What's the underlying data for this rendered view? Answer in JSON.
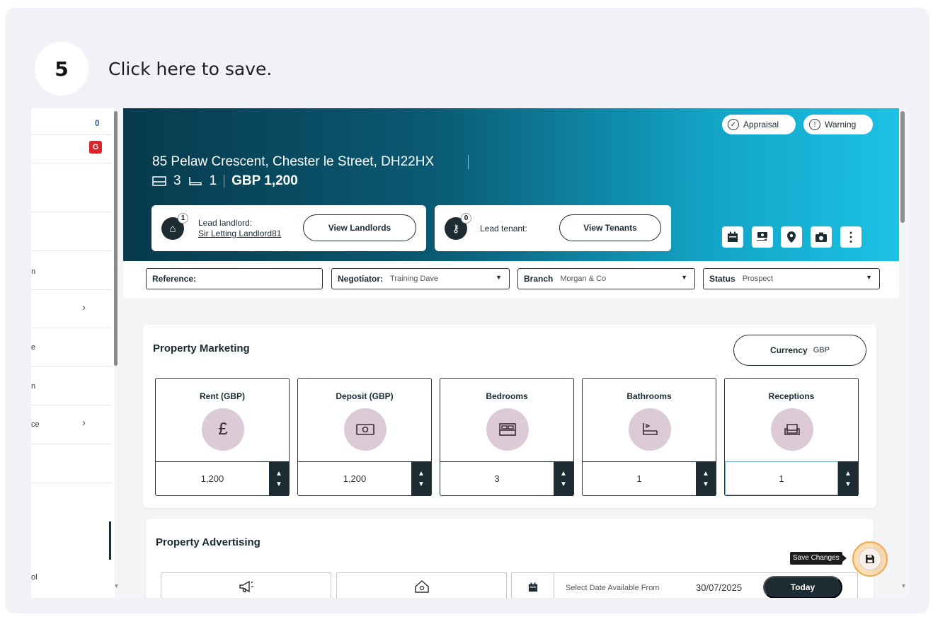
{
  "step": {
    "number": "5",
    "instruction": "Click here to save."
  },
  "sidebar": {
    "count": "0",
    "badge": "G",
    "fragments": [
      "n",
      "e",
      "n",
      "ce",
      "ol"
    ]
  },
  "header": {
    "tags": [
      {
        "icon": "✓",
        "label": "Appraisal"
      },
      {
        "icon": "!",
        "label": "Warning"
      }
    ],
    "address": "85 Pelaw Crescent, Chester le Street, DH22HX",
    "bedrooms": "3",
    "bathrooms": "1",
    "price": "GBP 1,200",
    "landlord": {
      "count": "1",
      "label": "Lead landlord:",
      "name": "Sir Letting Landlord81",
      "button": "View Landlords"
    },
    "tenant": {
      "count": "0",
      "label": "Lead tenant:",
      "button": "View Tenants"
    },
    "more": "⋮"
  },
  "filters": {
    "reference": {
      "label": "Reference:",
      "value": ""
    },
    "negotiator": {
      "label": "Negotiator:",
      "value": "Training Dave"
    },
    "branch": {
      "label": "Branch",
      "value": "Morgan & Co"
    },
    "status": {
      "label": "Status",
      "value": "Prospect"
    }
  },
  "marketing": {
    "title": "Property Marketing",
    "currency_label": "Currency",
    "currency_value": "GBP",
    "stats": [
      {
        "title": "Rent (GBP)",
        "icon": "£",
        "value": "1,200"
      },
      {
        "title": "Deposit (GBP)",
        "icon": "money",
        "value": "1,200"
      },
      {
        "title": "Bedrooms",
        "icon": "bed",
        "value": "3"
      },
      {
        "title": "Bathrooms",
        "icon": "bath",
        "value": "1"
      },
      {
        "title": "Receptions",
        "icon": "sofa",
        "value": "1"
      }
    ]
  },
  "advertising": {
    "title": "Property Advertising",
    "date_label": "Select Date Available From",
    "date_value": "30/07/2025",
    "today_button": "Today"
  },
  "save": {
    "tooltip": "Save Changes"
  },
  "colors": {
    "accent": "#1d2b33",
    "highlight": "#f2a84a",
    "icon_bg": "#dccad6"
  }
}
